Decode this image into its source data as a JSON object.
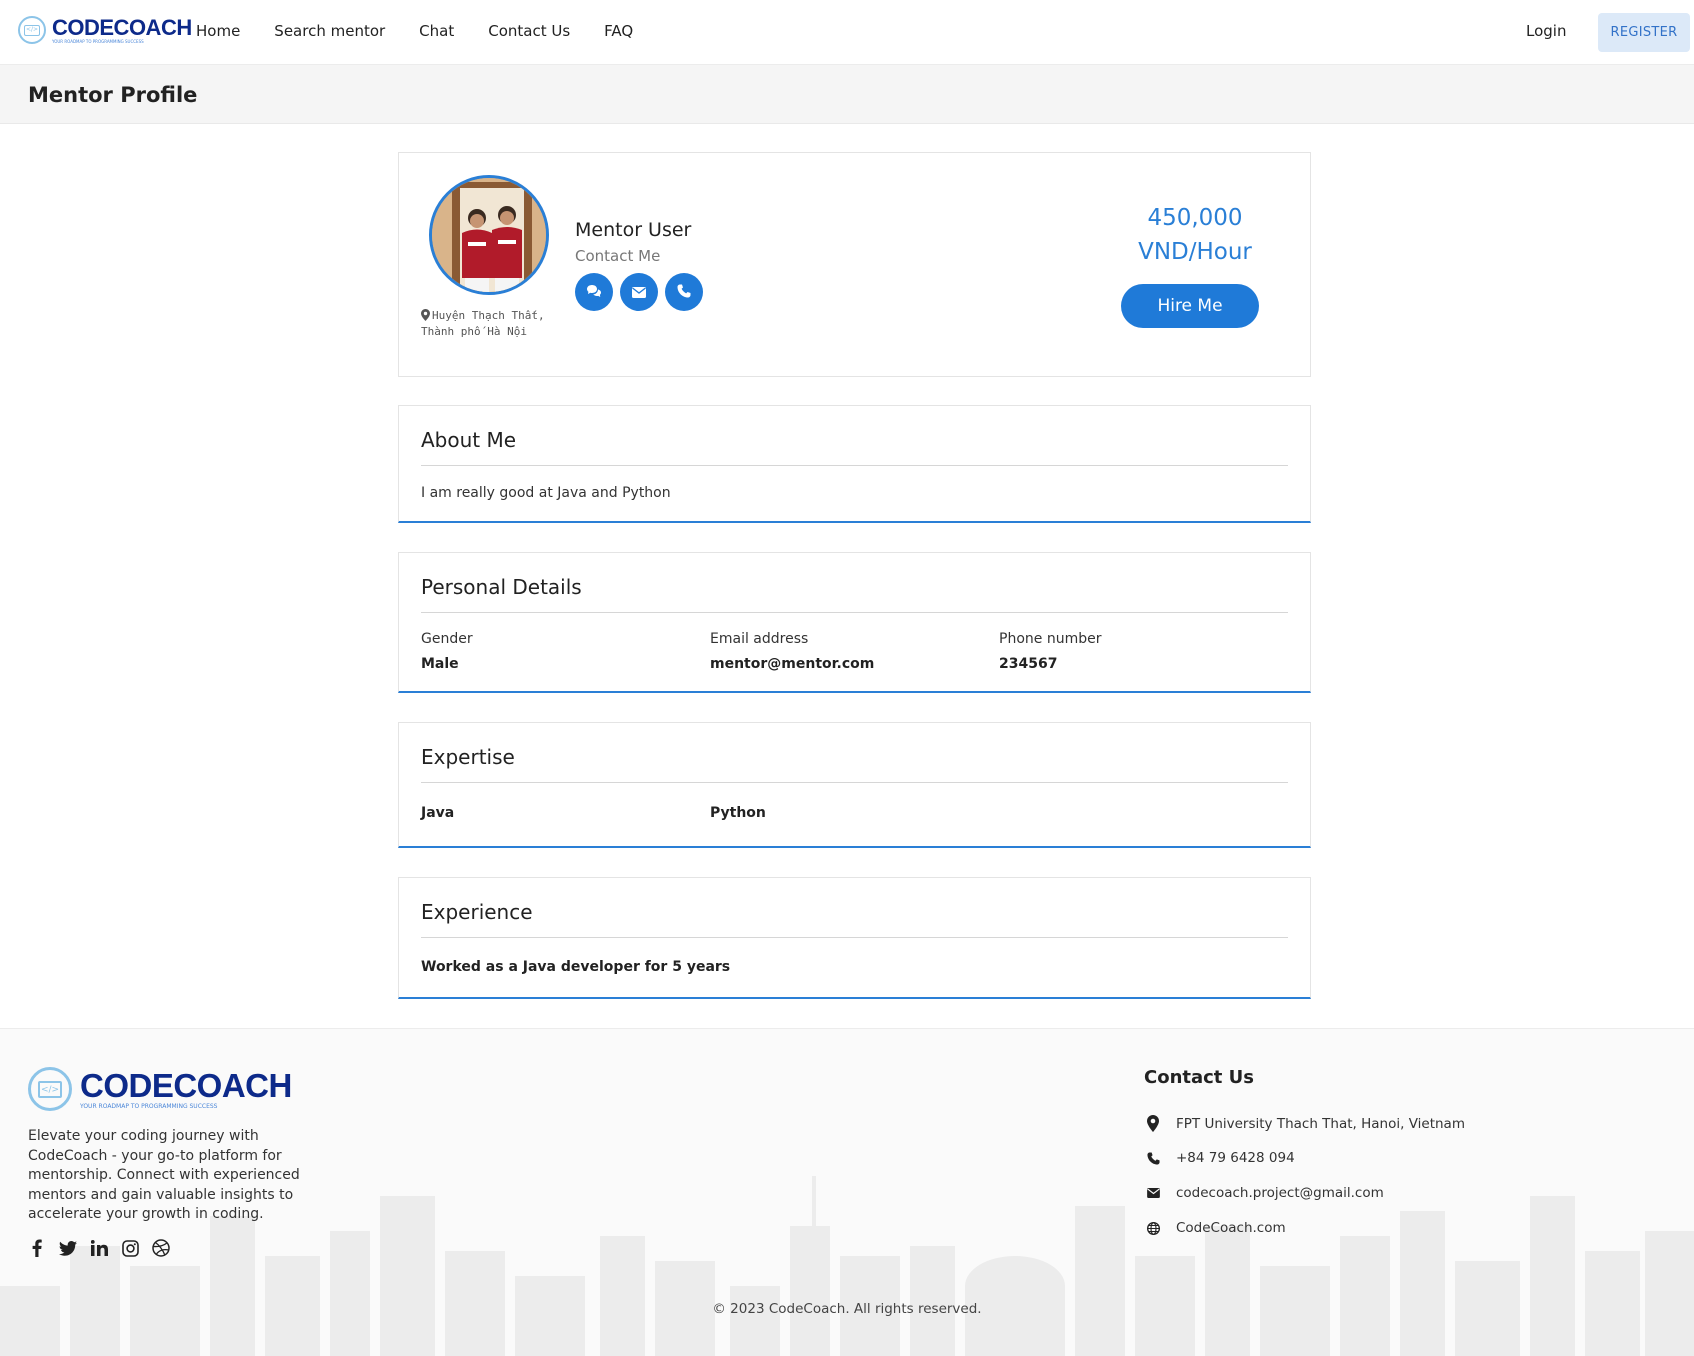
{
  "nav": {
    "logo_name": "CODECOACH",
    "logo_tagline": "YOUR ROADMAP TO PROGRAMMING SUCCESS",
    "links": [
      {
        "label": "Home"
      },
      {
        "label": "Search mentor"
      },
      {
        "label": "Chat"
      },
      {
        "label": "Contact Us"
      },
      {
        "label": "FAQ"
      }
    ],
    "login_label": "Login",
    "register_label": "REGISTER"
  },
  "page": {
    "title": "Mentor Profile"
  },
  "profile": {
    "name": "Mentor User",
    "contact_label": "Contact Me",
    "location": "Huyện Thạch Thất, Thành phố Hà Nội",
    "price": "450,000",
    "price_unit": "VND/Hour",
    "hire_label": "Hire Me",
    "contact_icons": [
      "chat-icon",
      "envelope-icon",
      "phone-icon"
    ]
  },
  "about": {
    "title": "About Me",
    "text": "I am really good at Java and Python"
  },
  "personal": {
    "title": "Personal Details",
    "gender_label": "Gender",
    "gender_value": "Male",
    "email_label": "Email address",
    "email_value": "mentor@mentor.com",
    "phone_label": "Phone number",
    "phone_value": "234567"
  },
  "expertise": {
    "title": "Expertise",
    "skills": [
      "Java",
      "Python"
    ]
  },
  "experience": {
    "title": "Experience",
    "text": "Worked as a Java developer for 5 years"
  },
  "footer": {
    "logo_name": "CODECOACH",
    "logo_tagline": "YOUR ROADMAP TO PROGRAMMING SUCCESS",
    "description": "Elevate your coding journey with CodeCoach - your go-to platform for mentorship. Connect with experienced mentors and gain valuable insights to accelerate your growth in coding.",
    "socials": [
      "facebook-icon",
      "twitter-icon",
      "linkedin-icon",
      "instagram-icon",
      "dribbble-icon"
    ],
    "contact_title": "Contact Us",
    "address": "FPT University Thach That, Hanoi, Vietnam",
    "phone": "+84 79 6428 094",
    "email": "codecoach.project@gmail.com",
    "website": "CodeCoach.com",
    "copyright": "© 2023 CodeCoach. All rights reserved."
  },
  "colors": {
    "primary": "#1f7ad8",
    "brand_navy": "#0d2a8a",
    "register_bg": "#dce9f8"
  }
}
